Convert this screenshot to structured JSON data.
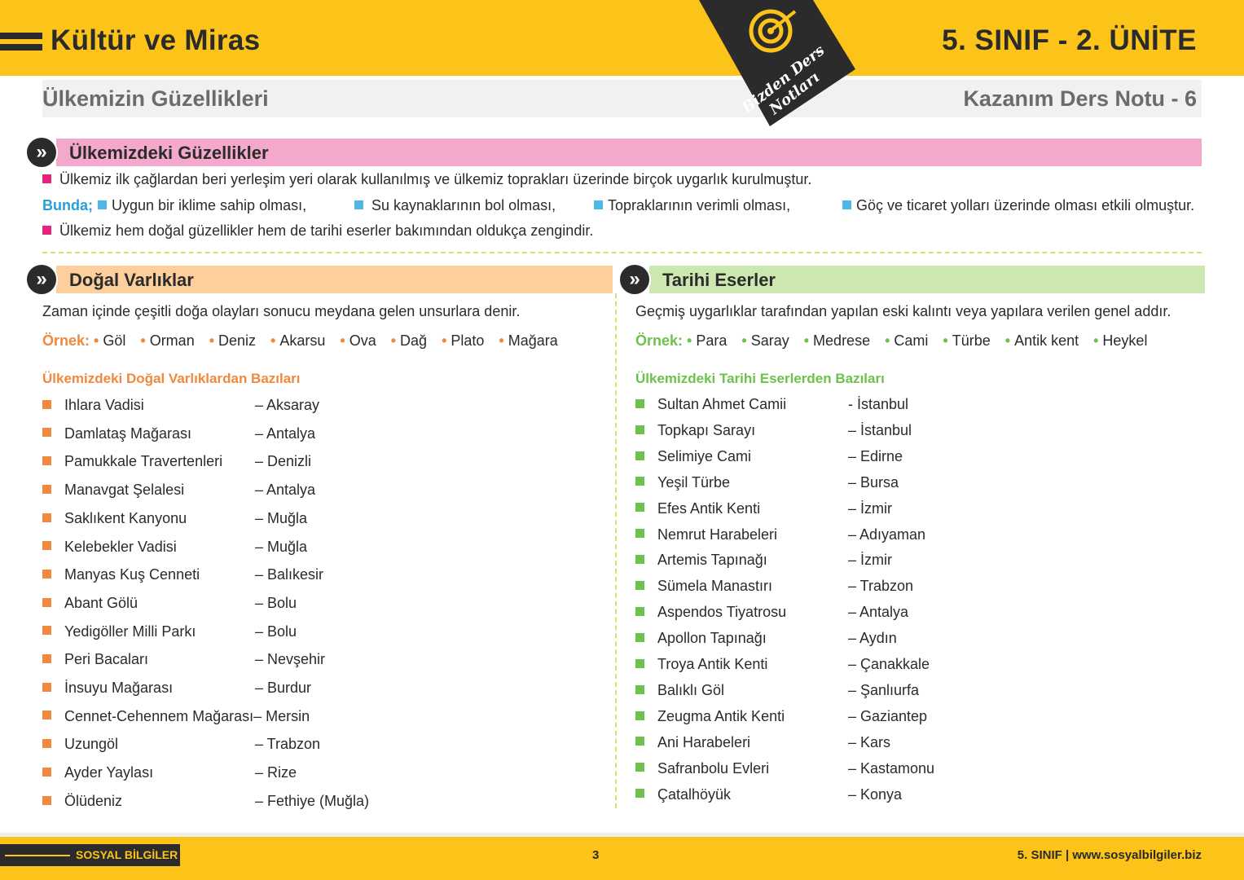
{
  "header": {
    "title": "Kültür ve Miras",
    "grade_unit": "5. SINIF - 2. ÜNİTE",
    "subtitle": "Ülkemizin Güzellikleri",
    "note_label": "Kazanım Ders Notu - 6",
    "badge_line1": "Bizden Ders",
    "badge_line2": "Notları"
  },
  "intro": {
    "heading": "Ülkemizdeki Güzellikler",
    "line1": "Ülkemiz ilk çağlardan beri yerleşim yeri olarak kullanılmış ve ülkemiz toprakları üzerinde birçok uygarlık kurulmuştur.",
    "bunda_label": "Bunda;",
    "reasons": [
      "Uygun bir iklime sahip olması,",
      "Su kaynaklarının bol olması,",
      "Topraklarının verimli olması,",
      "Göç ve ticaret yolları üzerinde olması etkili olmuştur."
    ],
    "line2": "Ülkemiz hem doğal güzellikler hem de tarihi eserler bakımından oldukça zengindir."
  },
  "natural": {
    "heading": "Doğal Varlıklar",
    "definition": "Zaman içinde çeşitli doğa olayları sonucu meydana gelen unsurlara denir.",
    "example_label": "Örnek:",
    "examples": [
      "Göl",
      "Orman",
      "Deniz",
      "Akarsu",
      "Ova",
      "Dağ",
      "Plato",
      "Mağara"
    ],
    "list_title": "Ülkemizdeki Doğal Varlıklardan Bazıları",
    "items": [
      {
        "name": "Ihlara Vadisi",
        "city": "– Aksaray"
      },
      {
        "name": "Damlataş Mağarası",
        "city": "– Antalya"
      },
      {
        "name": "Pamukkale Travertenleri",
        "city": "– Denizli"
      },
      {
        "name": "Manavgat Şelalesi",
        "city": "– Antalya"
      },
      {
        "name": "Saklıkent Kanyonu",
        "city": "– Muğla"
      },
      {
        "name": "Kelebekler Vadisi",
        "city": "– Muğla"
      },
      {
        "name": "Manyas Kuş Cenneti",
        "city": "– Balıkesir"
      },
      {
        "name": "Abant Gölü",
        "city": "– Bolu"
      },
      {
        "name": "Yedigöller Milli Parkı",
        "city": "– Bolu"
      },
      {
        "name": "Peri Bacaları",
        "city": "– Nevşehir"
      },
      {
        "name": "İnsuyu Mağarası",
        "city": "– Burdur"
      },
      {
        "name": "Cennet-Cehennem Mağarası",
        "city": "– Mersin"
      },
      {
        "name": "Uzungöl",
        "city": "– Trabzon"
      },
      {
        "name": "Ayder Yaylası",
        "city": "– Rize"
      },
      {
        "name": "Ölüdeniz",
        "city": "– Fethiye (Muğla)"
      }
    ]
  },
  "historic": {
    "heading": "Tarihi Eserler",
    "definition": "Geçmiş uygarlıklar tarafından yapılan eski kalıntı veya yapılara verilen genel addır.",
    "example_label": "Örnek:",
    "examples": [
      "Para",
      "Saray",
      "Medrese",
      "Cami",
      "Türbe",
      "Antik kent",
      "Heykel"
    ],
    "list_title": "Ülkemizdeki Tarihi Eserlerden Bazıları",
    "items": [
      {
        "name": "Sultan Ahmet Camii",
        "city": "- İstanbul"
      },
      {
        "name": "Topkapı Sarayı",
        "city": "– İstanbul"
      },
      {
        "name": "Selimiye Cami",
        "city": "– Edirne"
      },
      {
        "name": "Yeşil Türbe",
        "city": "– Bursa"
      },
      {
        "name": "Efes Antik Kenti",
        "city": "– İzmir"
      },
      {
        "name": "Nemrut Harabeleri",
        "city": "– Adıyaman"
      },
      {
        "name": "Artemis Tapınağı",
        "city": "– İzmir"
      },
      {
        "name": "Sümela Manastırı",
        "city": "– Trabzon"
      },
      {
        "name": "Aspendos Tiyatrosu",
        "city": "– Antalya"
      },
      {
        "name": "Apollon Tapınağı",
        "city": "– Aydın"
      },
      {
        "name": "Troya Antik Kenti",
        "city": "– Çanakkale"
      },
      {
        "name": "Balıklı Göl",
        "city": "– Şanlıurfa"
      },
      {
        "name": "Zeugma Antik Kenti",
        "city": "– Gaziantep"
      },
      {
        "name": "Ani Harabeleri",
        "city": "– Kars"
      },
      {
        "name": "Safranbolu Evleri",
        "city": "– Kastamonu"
      },
      {
        "name": "Çatalhöyük",
        "city": "– Konya"
      }
    ]
  },
  "footer": {
    "subject": "SOSYAL BİLGİLER",
    "page": "3",
    "site": "5. SINIF  |  www.sosyalbilgiler.biz"
  },
  "colors": {
    "yellow": "#fcc419",
    "pink_bar": "#f4a8cb",
    "orange_bar": "#fccf9c",
    "green_bar": "#cde7b0",
    "orange_text": "#f0883e",
    "green_text": "#6cc24a"
  }
}
